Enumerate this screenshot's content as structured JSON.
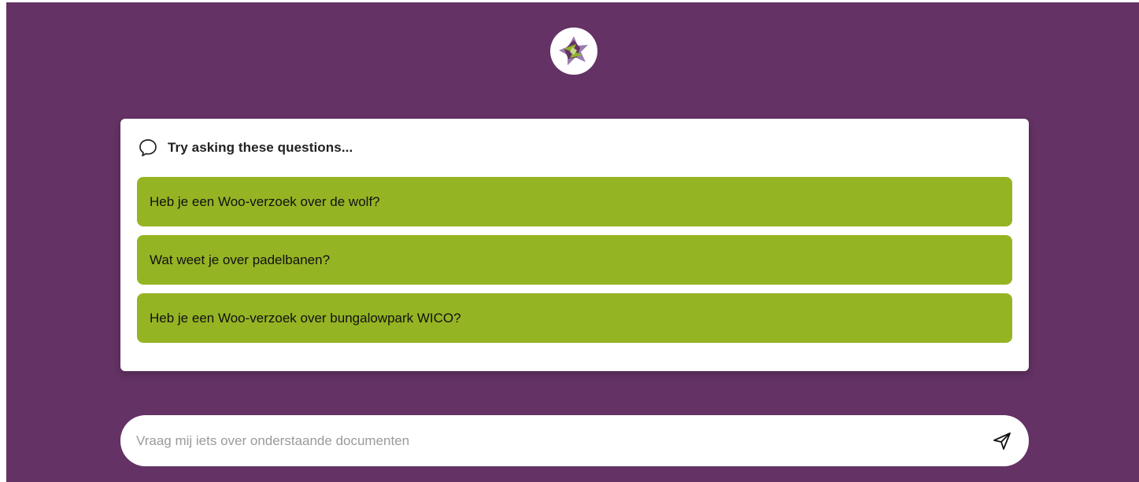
{
  "header": {
    "logo_icon": "star-logo-icon",
    "logo_colors": [
      "#8fb02a",
      "#643264",
      "#9a7db0"
    ]
  },
  "suggestions": {
    "icon": "chat-bubble-icon",
    "title": "Try asking these questions...",
    "items": [
      {
        "label": "Heb je een Woo-verzoek over de wolf?"
      },
      {
        "label": "Wat weet je over padelbanen?"
      },
      {
        "label": "Heb je een Woo-verzoek over bungalowpark WICO?"
      }
    ]
  },
  "chat": {
    "placeholder": "Vraag mij iets over onderstaande documenten",
    "value": "",
    "send_icon": "send-icon"
  },
  "colors": {
    "background": "#643264",
    "accent": "#95b424",
    "card": "#ffffff"
  }
}
